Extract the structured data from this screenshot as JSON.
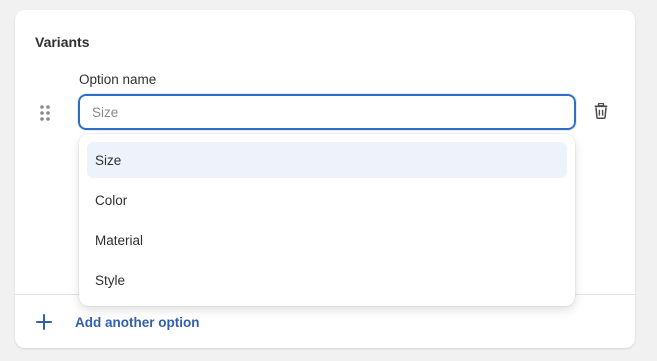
{
  "card": {
    "title": "Variants"
  },
  "option": {
    "label": "Option name",
    "placeholder": "Size",
    "value": ""
  },
  "dropdown": {
    "items": [
      {
        "label": "Size",
        "highlighted": true
      },
      {
        "label": "Color",
        "highlighted": false
      },
      {
        "label": "Material",
        "highlighted": false
      },
      {
        "label": "Style",
        "highlighted": false
      }
    ]
  },
  "footer": {
    "add_label": "Add another option"
  },
  "icons": {
    "drag": "drag-handle-icon",
    "delete": "trash-icon",
    "add": "plus-icon"
  },
  "colors": {
    "accent": "#2f6ec8",
    "link": "#2f5fad",
    "highlight": "#eef3fb"
  }
}
